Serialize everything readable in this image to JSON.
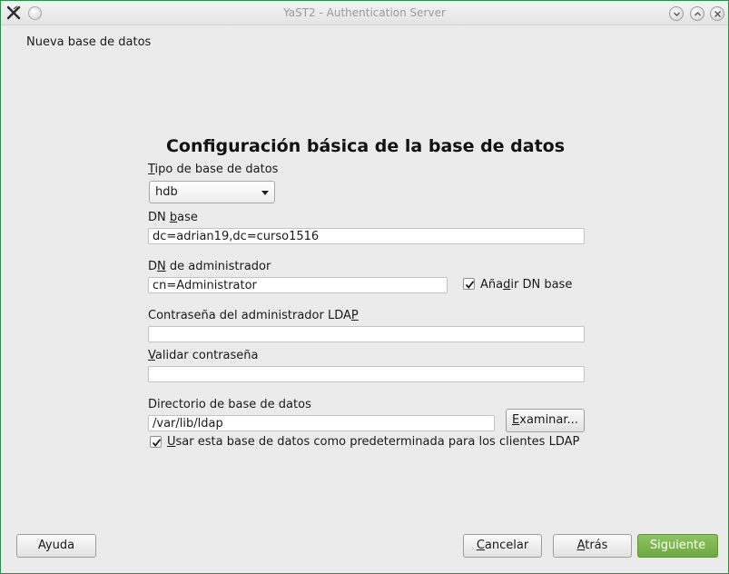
{
  "window": {
    "title": "YaST2 - Authentication Server"
  },
  "step_title": "Nueva base de datos",
  "heading": "Configuración básica de la base de datos",
  "db_type": {
    "label_mnemonic": "T",
    "label_rest": "ipo de base de datos",
    "value": "hdb"
  },
  "base_dn": {
    "label_pre": "DN ",
    "label_mnemonic": "b",
    "label_post": "ase",
    "value": "dc=adrian19,dc=curso1516"
  },
  "admin_dn": {
    "label_pre": "D",
    "label_mnemonic": "N",
    "label_post": " de administrador",
    "value": "cn=Administrator",
    "append_base_label_pre": "Aña",
    "append_base_label_mnemonic": "d",
    "append_base_label_post": "ir DN base",
    "append_base_checked": true
  },
  "admin_password": {
    "label_pre": "Contraseña del administrador LDA",
    "label_mnemonic": "P",
    "label_post": "",
    "value": ""
  },
  "validate_password": {
    "label_mnemonic": "V",
    "label_rest": "alidar contraseña",
    "value": ""
  },
  "db_directory": {
    "label": "Directorio de base de datos",
    "value": "/var/lib/ldap",
    "browse_mnemonic": "E",
    "browse_rest": "xaminar..."
  },
  "default_db": {
    "label_mnemonic": "U",
    "label_rest": "sar esta base de datos como predeterminada para los clientes LDAP",
    "checked": true
  },
  "buttons": {
    "help": "Ayuda",
    "cancel_mnemonic": "C",
    "cancel_rest": "ancelar",
    "back_mnemonic": "A",
    "back_rest": "trás",
    "next": "Siguiente"
  },
  "colors": {
    "primary_button": "#7ab54d",
    "window_border": "#2f8a4c",
    "background": "#ebebeb"
  },
  "icons": {
    "app": "yast-logo-icon",
    "pin": "pin-icon",
    "minimize": "minimize-icon",
    "maximize": "maximize-icon",
    "close": "close-icon",
    "combo_arrow": "chevron-down-icon",
    "check": "checkmark-icon"
  }
}
